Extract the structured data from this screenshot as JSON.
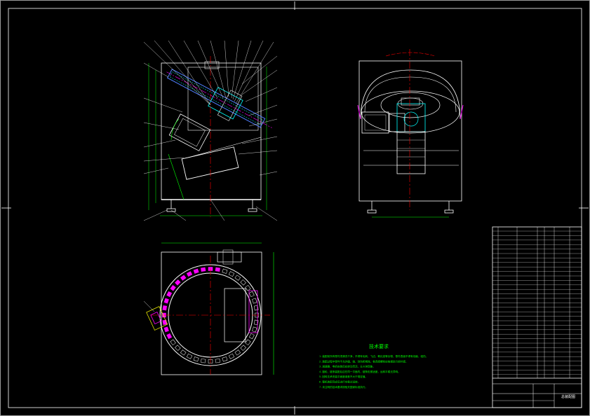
{
  "drawing": {
    "tech_req_title": "技术要求",
    "tech_req_lines": [
      "1.装配前所有零件须清洗干净，不得有毛刺、飞边、氧化皮等杂物，零件表面不得有划痕、碰伤。",
      "2.装配过程中零件不允许磕、碰、划伤和锈蚀，各连接螺栓应按规定力矩拧紧。",
      "3.减速器、电机安装后应转动灵活，无卡滞现象。",
      "4.链轮、链条装配后应在同一平面内，链条松紧适度，运转平稳无异响。",
      "5.回转支承安装平面度误差不大于规定值。",
      "6.整机装配完成后进行空载试运转。",
      "7.未注明的技术要求按相关国家标准执行。"
    ],
    "title_block": {
      "drawing_name": "总装配图"
    }
  },
  "colors": {
    "frame": "#ffffff",
    "part": "#ffffff",
    "dimension": "#00ff00",
    "centerline": "#ff0000",
    "highlight": "#ff00ff",
    "blue": "#4f7fff",
    "cyan": "#00ffff",
    "yellow": "#ffff00",
    "green_text": "#00ff00"
  }
}
